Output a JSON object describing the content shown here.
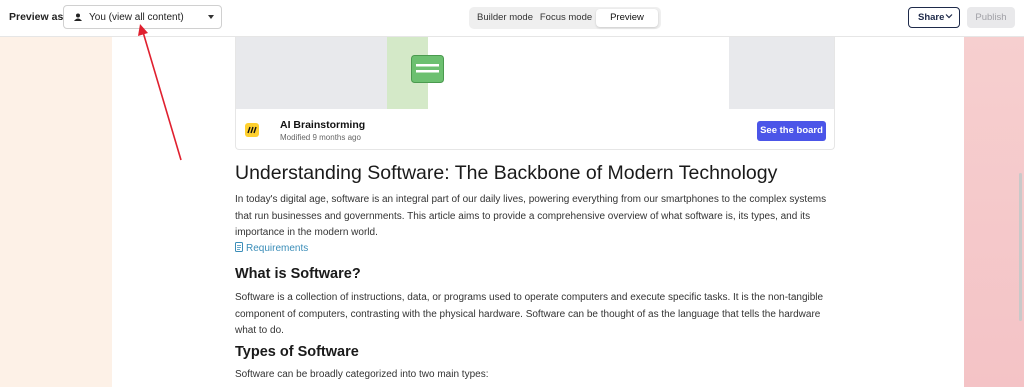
{
  "topbar": {
    "preview_as_label": "Preview as",
    "viewer_select_value": "You (view all content)",
    "modes": [
      "Builder mode",
      "Focus mode",
      "Preview"
    ],
    "active_mode": "Preview",
    "share_label": "Share",
    "publish_label": "Publish"
  },
  "embed": {
    "title": "AI Brainstorming",
    "modified": "Modified 9 months ago",
    "see_board_label": "See the board"
  },
  "article": {
    "title": "Understanding Software: The Backbone of Modern Technology",
    "intro": "In today's digital age, software is an integral part of our daily lives, powering everything from our smartphones to the complex systems that run businesses and governments. This article aims to provide a comprehensive overview of what software is, its types, and its importance in the modern world.",
    "requirements_link": "Requirements",
    "h2_what": "What is Software?",
    "what_para": "Software is a collection of instructions, data, or programs used to operate computers and execute specific tasks. It is the non-tangible component of computers, contrasting with the physical hardware. Software can be thought of as the language that tells the hardware what to do.",
    "h2_types": "Types of Software",
    "types_para": "Software can be broadly categorized into two main types:"
  },
  "colors": {
    "accent": "#4b55e8",
    "link": "#3a8db8",
    "annotation_arrow": "#e0202f"
  }
}
